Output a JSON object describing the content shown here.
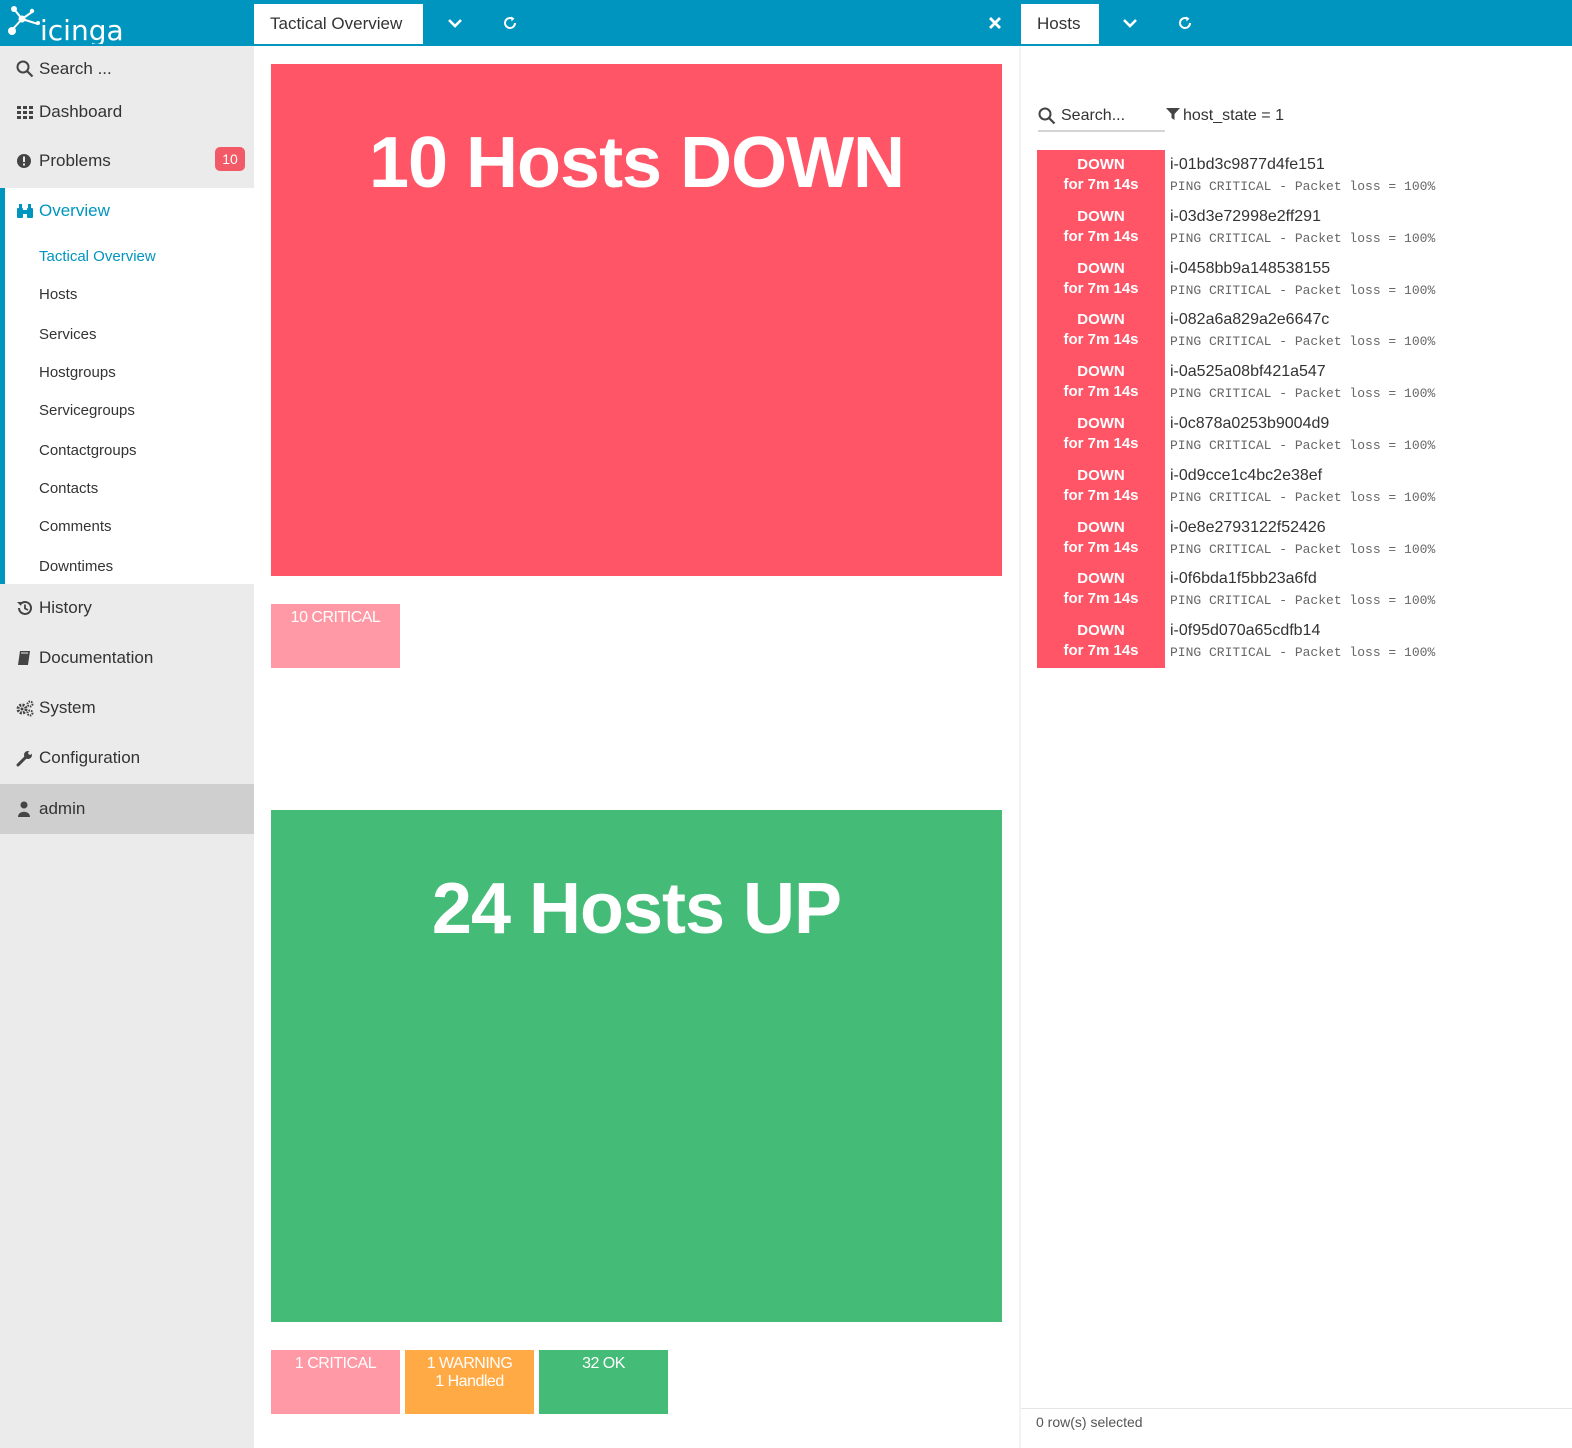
{
  "app": {
    "logo_text": "icinga",
    "accent": "#0095bf"
  },
  "tabs": [
    {
      "label": "Tactical Overview"
    },
    {
      "label": "Hosts"
    }
  ],
  "sidebar": {
    "search_placeholder": "Search ...",
    "items": [
      {
        "label": "Dashboard",
        "icon": "dashboard-grid-icon"
      },
      {
        "label": "Problems",
        "icon": "exclamation-icon",
        "badge": "10"
      },
      {
        "label": "Overview",
        "icon": "binoculars-icon",
        "active": true
      },
      {
        "label": "History",
        "icon": "history-icon"
      },
      {
        "label": "Documentation",
        "icon": "book-icon"
      },
      {
        "label": "System",
        "icon": "cogs-icon"
      },
      {
        "label": "Configuration",
        "icon": "wrench-icon"
      },
      {
        "label": "admin",
        "icon": "user-icon"
      }
    ],
    "overview_sub": [
      "Tactical Overview",
      "Hosts",
      "Services",
      "Hostgroups",
      "Servicegroups",
      "Contactgroups",
      "Contacts",
      "Comments",
      "Downtimes"
    ]
  },
  "tactical": {
    "down": {
      "title": "10 Hosts DOWN",
      "color": "#ff5566",
      "services": [
        {
          "label": "10 CRITICAL",
          "color": "#ff99a5"
        }
      ]
    },
    "up": {
      "title": "24 Hosts UP",
      "color": "#44bb77",
      "services": [
        {
          "label": "1 CRITICAL",
          "color": "#ff99a5"
        },
        {
          "label": "1 WARNING",
          "sub": "1 Handled",
          "color": "#ffaa44"
        },
        {
          "label": "32 OK",
          "color": "#44bb77"
        }
      ]
    }
  },
  "hosts_panel": {
    "search_placeholder": "Search...",
    "filter": "host_state = 1",
    "rows": [
      {
        "state": "DOWN",
        "duration": "for 7m 14s",
        "name": "i-01bd3c9877d4fe151",
        "output": "PING CRITICAL - Packet loss = 100%"
      },
      {
        "state": "DOWN",
        "duration": "for 7m 14s",
        "name": "i-03d3e72998e2ff291",
        "output": "PING CRITICAL - Packet loss = 100%"
      },
      {
        "state": "DOWN",
        "duration": "for 7m 14s",
        "name": "i-0458bb9a148538155",
        "output": "PING CRITICAL - Packet loss = 100%"
      },
      {
        "state": "DOWN",
        "duration": "for 7m 14s",
        "name": "i-082a6a829a2e6647c",
        "output": "PING CRITICAL - Packet loss = 100%"
      },
      {
        "state": "DOWN",
        "duration": "for 7m 14s",
        "name": "i-0a525a08bf421a547",
        "output": "PING CRITICAL - Packet loss = 100%"
      },
      {
        "state": "DOWN",
        "duration": "for 7m 14s",
        "name": "i-0c878a0253b9004d9",
        "output": "PING CRITICAL - Packet loss = 100%"
      },
      {
        "state": "DOWN",
        "duration": "for 7m 14s",
        "name": "i-0d9cce1c4bc2e38ef",
        "output": "PING CRITICAL - Packet loss = 100%"
      },
      {
        "state": "DOWN",
        "duration": "for 7m 14s",
        "name": "i-0e8e2793122f52426",
        "output": "PING CRITICAL - Packet loss = 100%"
      },
      {
        "state": "DOWN",
        "duration": "for 7m 14s",
        "name": "i-0f6bda1f5bb23a6fd",
        "output": "PING CRITICAL - Packet loss = 100%"
      },
      {
        "state": "DOWN",
        "duration": "for 7m 14s",
        "name": "i-0f95d070a65cdfb14",
        "output": "PING CRITICAL - Packet loss = 100%"
      }
    ],
    "footer": "0 row(s) selected"
  }
}
